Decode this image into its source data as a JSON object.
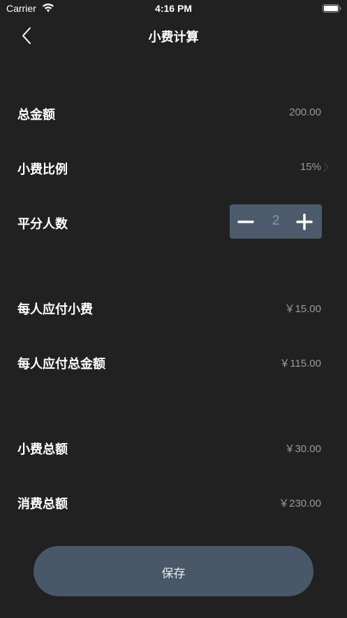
{
  "status_bar": {
    "carrier": "Carrier",
    "time": "4:16 PM"
  },
  "nav": {
    "title": "小费计算"
  },
  "total_amount": {
    "label": "总金额",
    "value": "200.00"
  },
  "tip_rate": {
    "label": "小费比例",
    "value": "15%"
  },
  "split": {
    "label": "平分人数",
    "value": "2"
  },
  "tip_per_person": {
    "label": "每人应付小费",
    "value": "￥15.00"
  },
  "total_per_person": {
    "label": "每人应付总金额",
    "value": "￥115.00"
  },
  "tip_total": {
    "label": "小费总额",
    "value": "￥30.00"
  },
  "bill_total": {
    "label": "消费总额",
    "value": "￥230.00"
  },
  "actions": {
    "save_label": "保存"
  },
  "colors": {
    "background": "#212121",
    "stepper_bg": "#4b5b6c",
    "button_bg": "#485868",
    "value_text": "#9a9a9a"
  },
  "icons": {
    "back": "chevron-left-icon",
    "chevron": "chevron-right-icon",
    "minus": "minus-icon",
    "plus": "plus-icon",
    "wifi": "wifi-icon",
    "battery": "battery-icon"
  }
}
